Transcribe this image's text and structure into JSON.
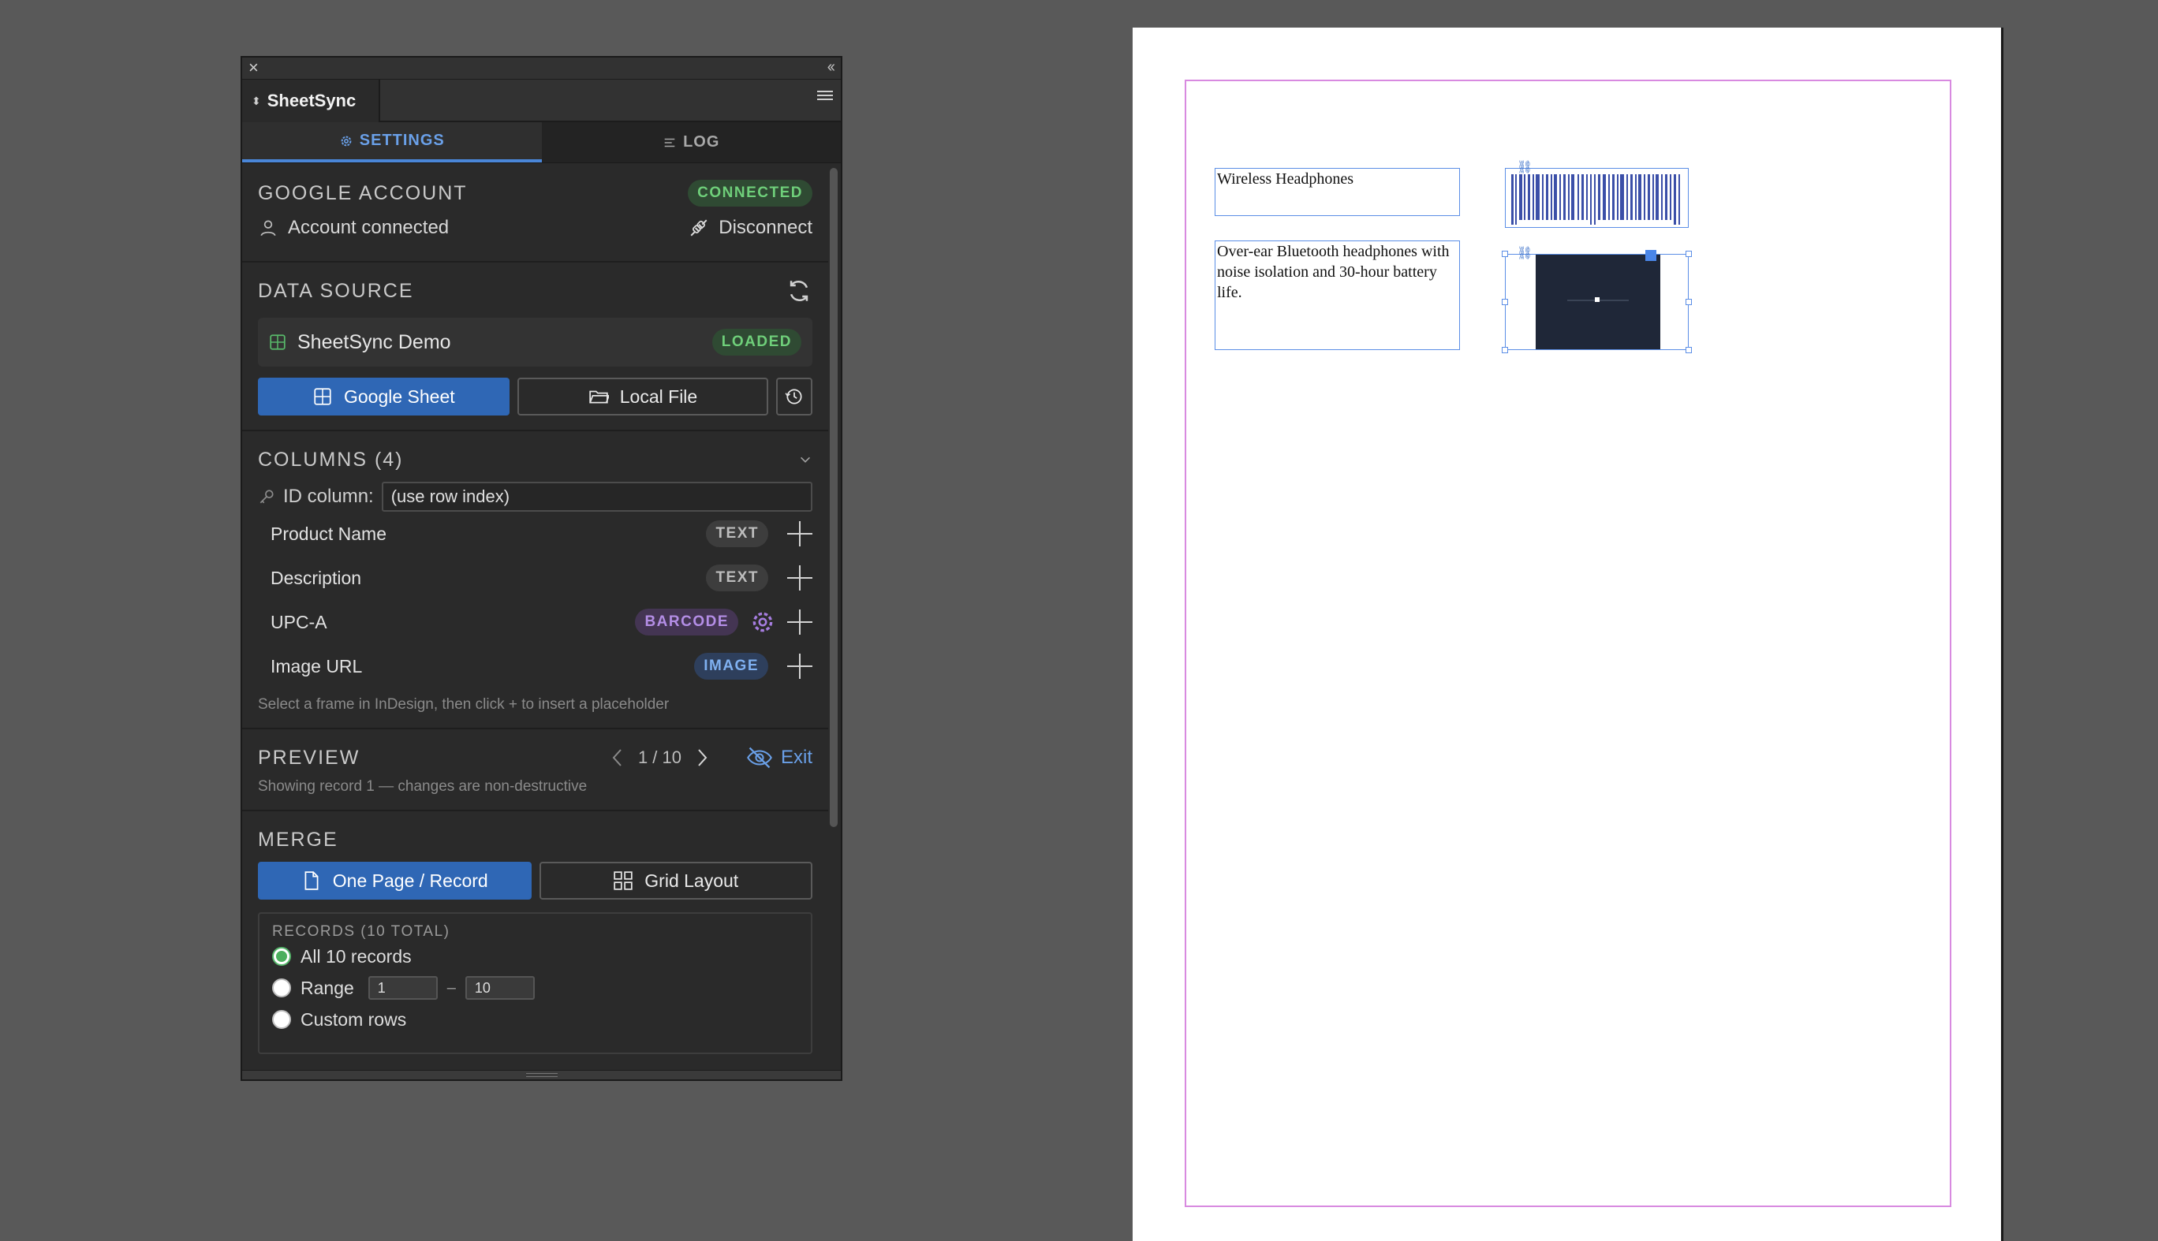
{
  "panel": {
    "close_glyph": "×",
    "collapse_glyph": "‹‹",
    "tab_name": "SheetSync",
    "tab_arrows": "⬍",
    "nav": {
      "settings": "SETTINGS",
      "log": "LOG"
    }
  },
  "account": {
    "title": "GOOGLE ACCOUNT",
    "status": "CONNECTED",
    "label": "Account connected",
    "disconnect": "Disconnect"
  },
  "source": {
    "title": "DATA SOURCE",
    "name": "SheetSync Demo",
    "status": "LOADED",
    "btn_sheet": "Google Sheet",
    "btn_local": "Local File"
  },
  "columns": {
    "title": "COLUMNS (4)",
    "id_label": "ID column:",
    "id_value": "(use row index)",
    "items": [
      {
        "name": "Product Name",
        "type": "TEXT"
      },
      {
        "name": "Description",
        "type": "TEXT"
      },
      {
        "name": "UPC-A",
        "type": "BARCODE"
      },
      {
        "name": "Image URL",
        "type": "IMAGE"
      }
    ],
    "hint": "Select a frame in InDesign, then click + to insert a placeholder"
  },
  "preview": {
    "title": "PREVIEW",
    "position": "1 / 10",
    "exit": "Exit",
    "note": "Showing record 1 — changes are non-destructive"
  },
  "merge": {
    "title": "MERGE",
    "btn_one": "One Page / Record",
    "btn_grid": "Grid Layout",
    "records_label": "RECORDS (10 TOTAL)",
    "opt_all": "All 10 records",
    "opt_range": "Range",
    "range_from": "1",
    "range_dash": "–",
    "range_to": "10",
    "opt_custom": "Custom rows"
  },
  "document": {
    "product_name": "Wireless Headphones",
    "description": "Over-ear Bluetooth headphones with noise isolation and 30-hour battery life."
  },
  "colors": {
    "accent": "#2f67b5",
    "connected": "#6fcf7a",
    "margin_guide": "#d88ae0"
  }
}
